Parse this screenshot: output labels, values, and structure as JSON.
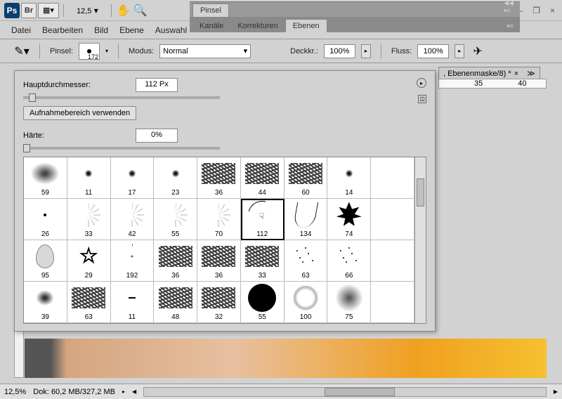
{
  "window": {
    "minimize": "—",
    "restore": "❐",
    "close": "×"
  },
  "toolbar": {
    "ps": "Ps",
    "br": "Br",
    "zoom": "12,5",
    "hand": "✋",
    "magnify": "🔍"
  },
  "panels": {
    "pinsel": "Pinsel",
    "kanale": "Kanäle",
    "korrekturen": "Korrekturen",
    "ebenen": "Ebenen",
    "docTab": ", Ebenenmaske/8) *",
    "docClose": "×"
  },
  "menu": {
    "datei": "Datei",
    "bearbeiten": "Bearbeiten",
    "bild": "Bild",
    "ebene": "Ebene",
    "auswahl": "Auswahl"
  },
  "options": {
    "pinselLabel": "Pinsel:",
    "brushSize": "172",
    "modusLabel": "Modus:",
    "modusValue": "Normal",
    "deckkrLabel": "Deckkr.:",
    "deckkrValue": "100%",
    "flussLabel": "Fluss:",
    "flussValue": "100%"
  },
  "popup": {
    "diameterLabel": "Hauptdurchmesser:",
    "diameterValue": "112 Px",
    "useSampleBtn": "Aufnahmebereich verwenden",
    "hardnessLabel": "Härte:",
    "hardnessValue": "0%",
    "flyout": "▸"
  },
  "brushes": [
    [
      {
        "s": "spray-L",
        "v": "59"
      },
      {
        "s": "spray-S",
        "v": "11"
      },
      {
        "s": "spray-S",
        "v": "17"
      },
      {
        "s": "spray-S",
        "v": "23"
      },
      {
        "s": "texture",
        "v": "36"
      },
      {
        "s": "texture",
        "v": "44"
      },
      {
        "s": "texture",
        "v": "60"
      },
      {
        "s": "spray-S",
        "v": "14"
      },
      {
        "s": "",
        "v": ""
      }
    ],
    [
      {
        "s": "dot-tiny",
        "v": "26"
      },
      {
        "s": "starburst",
        "v": "33"
      },
      {
        "s": "starburst",
        "v": "42"
      },
      {
        "s": "starburst",
        "v": "55"
      },
      {
        "s": "starburst",
        "v": "70"
      },
      {
        "s": "grass-arc",
        "v": "112",
        "sel": true
      },
      {
        "s": "grass-v",
        "v": "134"
      },
      {
        "s": "leaf-maple",
        "v": "74"
      },
      {
        "s": "",
        "v": ""
      }
    ],
    [
      {
        "s": "leaf-simple",
        "v": "95"
      },
      {
        "s": "star-outline",
        "v": "29",
        "txt": "☆"
      },
      {
        "s": "burst",
        "v": "192"
      },
      {
        "s": "texture",
        "v": "36"
      },
      {
        "s": "texture",
        "v": "36"
      },
      {
        "s": "texture",
        "v": "33"
      },
      {
        "s": "speckle",
        "v": "63"
      },
      {
        "s": "speckle",
        "v": "66"
      },
      {
        "s": "",
        "v": ""
      }
    ],
    [
      {
        "s": "spray-M",
        "v": "39"
      },
      {
        "s": "texture",
        "v": "63"
      },
      {
        "s": "dash-tiny",
        "v": "11"
      },
      {
        "s": "texture",
        "v": "48"
      },
      {
        "s": "texture",
        "v": "32"
      },
      {
        "s": "solid-circle",
        "v": "55"
      },
      {
        "s": "dots-ring",
        "v": "100"
      },
      {
        "s": "soft-circle",
        "v": "75"
      },
      {
        "s": "",
        "v": ""
      }
    ]
  ],
  "ruler": {
    "m35": "35",
    "m40": "40"
  },
  "status": {
    "zoom": "12,5%",
    "doc": "Dok: 60,2 MB/327,2 MB"
  }
}
